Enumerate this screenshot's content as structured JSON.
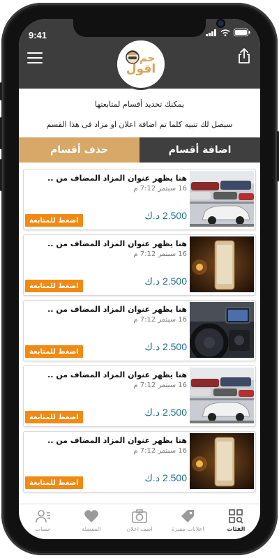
{
  "status": {
    "time": "9:41"
  },
  "logo": {
    "line1": "جم",
    "line2": "اقول"
  },
  "intro": {
    "line1": "يمكنك تحديد أقسام لمتابعتها",
    "line2": "سيصل لك تنبيه كلما تم اضافة اعلان او مزاد فى هذا القسم"
  },
  "tabs": {
    "remove": "حذف أقسام",
    "add": "اضافة أقسام"
  },
  "items": [
    {
      "title": "هنا يظهر عنوان المزاد المضاف من ..",
      "date": "16 سبتمر 7:12 م",
      "price": "2.500 د.ك",
      "follow": "اضغط للمتابعة",
      "thumb": "cars-lot"
    },
    {
      "title": "هنا يظهر عنوان المزاد المضاف من ..",
      "date": "16 سبتمر 7:12 م",
      "price": "2.500 د.ك",
      "follow": "اضغط للمتابعة",
      "thumb": "phone-gold"
    },
    {
      "title": "هنا يظهر عنوان المزاد المضاف من ..",
      "date": "16 سبتمر 7:12 م",
      "price": "2.500 د.ك",
      "follow": "اضغط للمتابعة",
      "thumb": "car-interior"
    },
    {
      "title": "هنا يظهر عنوان المزاد المضاف من ..",
      "date": "16 سبتمر 7:12 م",
      "price": "2.500 د.ك",
      "follow": "اضغط للمتابعة",
      "thumb": "cars-lot"
    },
    {
      "title": "هنا يظهر عنوان المزاد المضاف من ..",
      "date": "16 سبتمر 7:12 م",
      "price": "2.500 د.ك",
      "follow": "اضغط للمتابعة",
      "thumb": "phone-gold"
    }
  ],
  "nav": [
    {
      "label": "حساب",
      "icon": "user-icon"
    },
    {
      "label": "المفضلة",
      "icon": "heart-icon"
    },
    {
      "label": "اضف اعلان",
      "icon": "camera-icon"
    },
    {
      "label": "اعلانات مميزة",
      "icon": "tag-icon"
    },
    {
      "label": "الفئات",
      "icon": "grid-icon",
      "active": true
    }
  ],
  "colors": {
    "appbar": "#3d3d3d",
    "accent": "#d7a867",
    "follow": "#f08a14",
    "price": "#1e6f8a"
  }
}
